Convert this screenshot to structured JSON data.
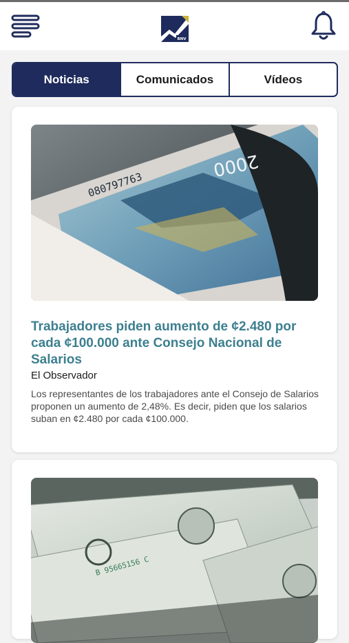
{
  "header": {
    "menu_icon": "hamburger-menu-icon",
    "logo": {
      "icon": "chart-arrow-logo",
      "text": "BNV"
    },
    "notification_icon": "bell-icon"
  },
  "tabs": [
    {
      "label": "Noticias",
      "active": true
    },
    {
      "label": "Comunicados",
      "active": false
    },
    {
      "label": "Vídeos",
      "active": false
    }
  ],
  "news": [
    {
      "image": {
        "description_icon": "colon-banknote-photo",
        "note_serial": "080797763",
        "note_value": "2000"
      },
      "title": "Trabajadores piden aumento de ¢2.480 por cada ¢100.000 ante Consejo Nacional de Salarios",
      "source": "El Observador",
      "summary": "Los representantes de los trabajadores ante el Consejo de Salarios proponen un aumento de 2,48%. Es decir, piden que los salarios suban en ¢2.480 por cada ¢100.000."
    },
    {
      "image": {
        "description_icon": "dollar-bills-photo",
        "note_serial": "B 95665156 C"
      }
    }
  ],
  "colors": {
    "primary": "#1f2b5c",
    "title_teal": "#3d7f8f",
    "background": "#f3f3f4"
  }
}
